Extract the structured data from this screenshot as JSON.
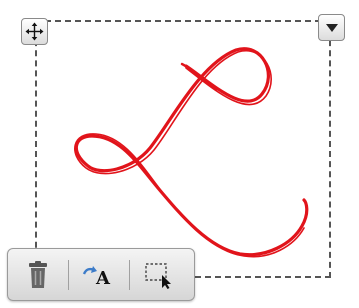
{
  "toolbar": {
    "buttons": [
      {
        "icon": "trash-icon"
      },
      {
        "icon": "text-style-icon"
      },
      {
        "icon": "select-region-icon"
      }
    ]
  },
  "corner_buttons": {
    "move": {
      "icon": "move-arrows-icon"
    },
    "menu": {
      "icon": "caret-down-icon"
    }
  },
  "signature": {
    "ink_color": "#e1141b"
  }
}
